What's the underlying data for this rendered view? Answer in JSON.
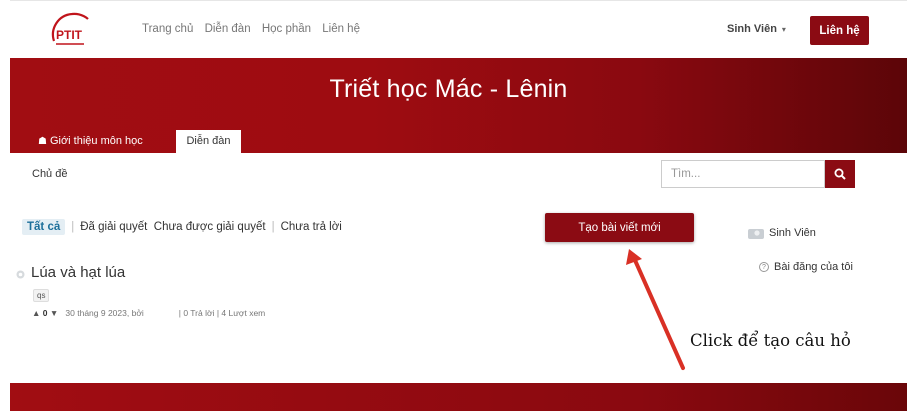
{
  "header": {
    "logo_text": "PTIT",
    "nav": [
      "Trang chủ",
      "Diễn đàn",
      "Học phần",
      "Liên hệ"
    ],
    "user_menu": "Sinh Viên",
    "contact_button": "Liên hệ"
  },
  "hero": {
    "title": "Triết học Mác - Lênin",
    "tabs": [
      {
        "label": "Giới thiệu môn học",
        "icon": "home-icon",
        "active": false
      },
      {
        "label": "Diễn đàn",
        "active": true
      }
    ]
  },
  "topics": {
    "label": "Chủ đề",
    "search_placeholder": "Tìm..."
  },
  "filters": {
    "all": "Tất cả",
    "resolved": "Đã giải quyết",
    "unresolved": "Chưa được giải quyết",
    "unanswered": "Chưa trả lời"
  },
  "new_post_button": "Tạo bài viết mới",
  "sidebar": {
    "user": "Sinh Viên",
    "my_posts": "Bài đăng của tôi"
  },
  "posts": [
    {
      "title": "Lúa và hạt lúa",
      "tag": "qs",
      "votes": "0",
      "date": "30 tháng 9 2023, bởi",
      "replies": "0 Trả lời",
      "views": "4 Lượt xem"
    }
  ],
  "annotation": "Click để tạo câu hỏ",
  "colors": {
    "brand": "#8b0b13",
    "hero_start": "#a10d12",
    "hero_end": "#5c0508",
    "filter_active_bg": "#e4eef4",
    "filter_active_text": "#1c6f9a",
    "arrow": "#d93025"
  }
}
